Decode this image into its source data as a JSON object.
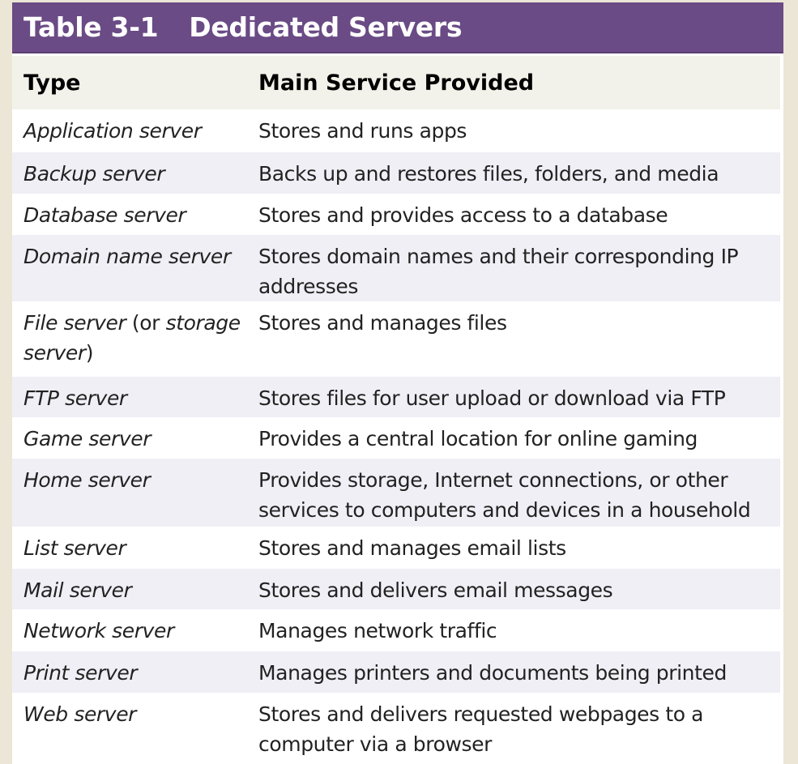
{
  "table": {
    "number": "Table 3-1",
    "title": "Dedicated Servers",
    "colors": {
      "title_bar": "#6a4b85",
      "header_row": "#f3f2ea",
      "alt_row": "#f0eff5",
      "background": "#ece6d6"
    },
    "headers": [
      "Type",
      "Main Service Provided"
    ],
    "rows": [
      {
        "type": "Application server",
        "service": "Stores and runs apps"
      },
      {
        "type": "Backup server",
        "service": "Backs up and restores files, folders, and media"
      },
      {
        "type": "Database server",
        "service": "Stores and provides access to a database"
      },
      {
        "type": "Domain name server",
        "service": "Stores domain names and their corresponding IP addresses"
      },
      {
        "type_parts": [
          "File server",
          " (or ",
          "storage server",
          ")"
        ],
        "service": "Stores and manages files"
      },
      {
        "type": "FTP server",
        "service": "Stores files for user upload or download via FTP"
      },
      {
        "type": "Game server",
        "service": "Provides a central location for online gaming"
      },
      {
        "type": "Home server",
        "service": "Provides storage, Internet connections, or other services to computers and devices in a household"
      },
      {
        "type": "List server",
        "service": "Stores and manages email lists"
      },
      {
        "type": "Mail server",
        "service": "Stores and delivers email messages"
      },
      {
        "type": "Network server",
        "service": "Manages network traffic"
      },
      {
        "type": "Print server",
        "service": "Manages printers and documents being printed"
      },
      {
        "type": "Web server",
        "service": "Stores and delivers requested webpages to a computer via a browser"
      }
    ]
  }
}
